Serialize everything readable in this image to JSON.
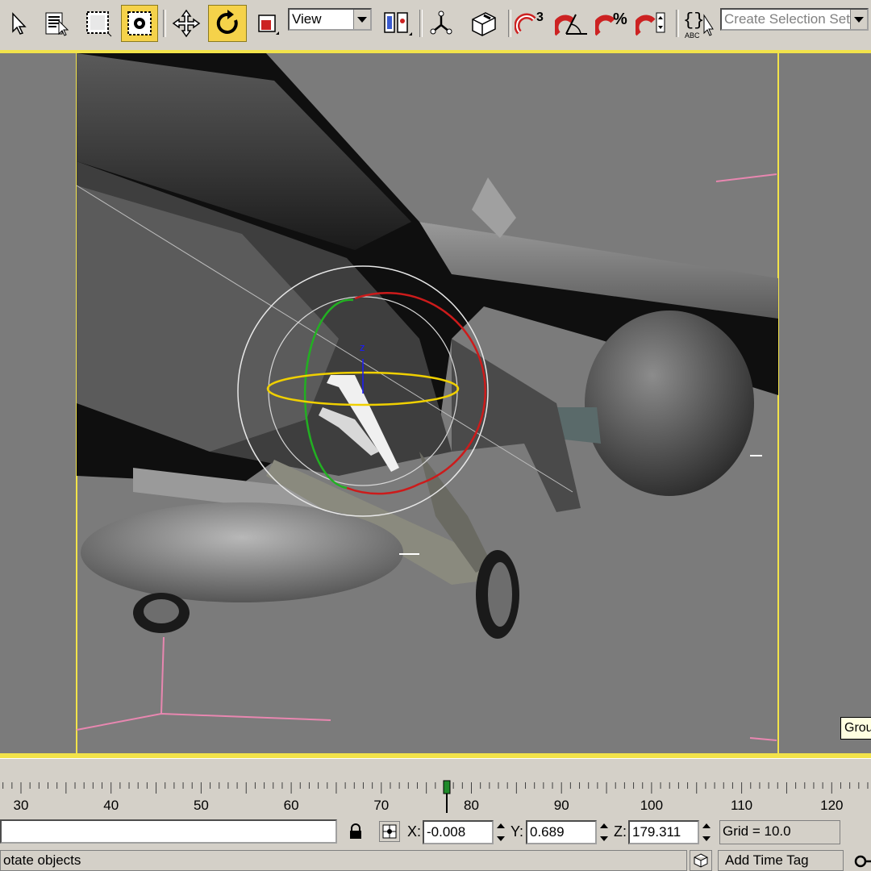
{
  "toolbar": {
    "ref_coord_value": "View",
    "selection_set_placeholder": "Create Selection Set",
    "snap_angle_label": "3",
    "snap_percent_label": "%",
    "named_sel_label": "ABC"
  },
  "viewport": {
    "tooltip": "Grou",
    "gizmo_axis_label": "z"
  },
  "timeline": {
    "ticks": [
      "30",
      "40",
      "50",
      "60",
      "70",
      "80",
      "90",
      "100",
      "110",
      "120"
    ],
    "current_frame": 77
  },
  "status": {
    "x_label": "X:",
    "x_value": "-0.008",
    "y_label": "Y:",
    "y_value": "0.689",
    "z_label": "Z:",
    "z_value": "179.311",
    "grid": "Grid = 10.0",
    "prompt": "otate objects",
    "add_time_tag": "Add Time Tag"
  },
  "colors": {
    "viewport_bg": "#7b7b7b",
    "viewport_border": "#f2e34a",
    "active_button": "#f5d24a",
    "ui_gray": "#d4d0c8"
  }
}
